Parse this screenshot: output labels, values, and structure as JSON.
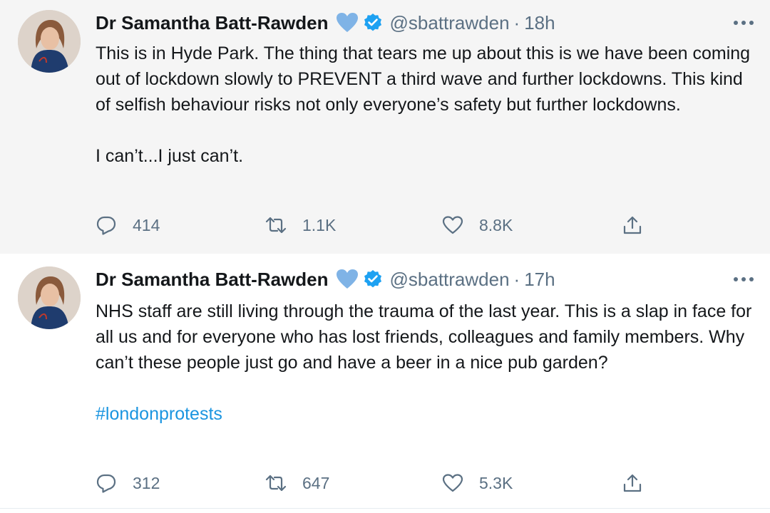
{
  "tweets": [
    {
      "author_name": "Dr Samantha Batt-Rawden",
      "handle": "@sbattrawden",
      "separator": "·",
      "time": "18h",
      "paragraphs": [
        "This is in Hyde Park. The thing that tears me up about this is we have been coming out of lockdown slowly to PREVENT a third wave and further lockdowns. This kind of selfish behaviour risks not only everyone’s safety but further lockdowns.",
        "I can’t...I just can’t."
      ],
      "hashtag": "",
      "replies": "414",
      "retweets": "1.1K",
      "likes": "8.8K"
    },
    {
      "author_name": "Dr Samantha Batt-Rawden",
      "handle": "@sbattrawden",
      "separator": "·",
      "time": "17h",
      "paragraphs": [
        "NHS staff are still living through the trauma of the last year. This is a slap in face for all us and for everyone who has lost friends, colleagues and family members. Why can’t these people just go and have a beer in a nice pub garden?"
      ],
      "hashtag": "#londonprotests",
      "replies": "312",
      "retweets": "647",
      "likes": "5.3K"
    }
  ],
  "colors": {
    "text": "#14171a",
    "muted": "#5b7083",
    "link": "#1b95e0",
    "verified": "#1da1f2",
    "heart_emoji": "#7fb3e6",
    "highlight_bg": "#f5f5f5"
  },
  "icons": {
    "name_emoji": "blue-heart-icon",
    "verified": "verified-badge-icon",
    "more": "more-options-icon",
    "reply": "reply-icon",
    "retweet": "retweet-icon",
    "like": "like-icon",
    "share": "share-icon"
  }
}
